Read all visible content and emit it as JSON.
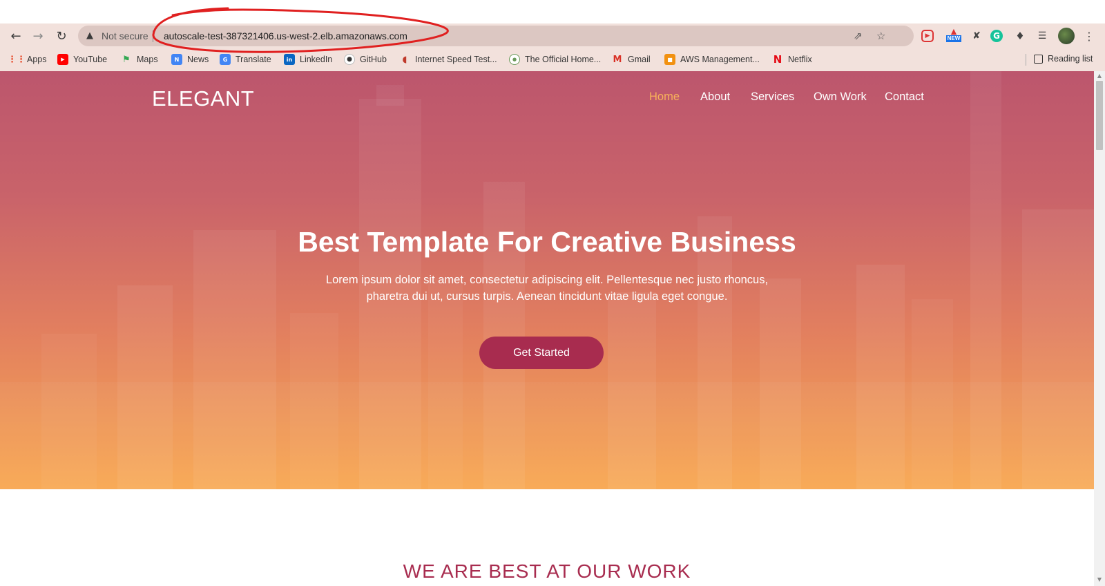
{
  "browser": {
    "security_label": "Not secure",
    "url": "autoscale-test-387321406.us-west-2.elb.amazonaws.com",
    "new_badge": "NEW",
    "bookmarks": [
      {
        "label": "Apps",
        "icon": "apps-grid-icon"
      },
      {
        "label": "YouTube",
        "icon": "youtube-icon"
      },
      {
        "label": "Maps",
        "icon": "maps-pin-icon"
      },
      {
        "label": "News",
        "icon": "google-news-icon"
      },
      {
        "label": "Translate",
        "icon": "google-translate-icon"
      },
      {
        "label": "LinkedIn",
        "icon": "linkedin-icon"
      },
      {
        "label": "GitHub",
        "icon": "github-icon"
      },
      {
        "label": "Internet Speed Test...",
        "icon": "speedometer-icon"
      },
      {
        "label": "The Official Home...",
        "icon": "official-home-icon"
      },
      {
        "label": "Gmail",
        "icon": "gmail-icon"
      },
      {
        "label": "AWS Management...",
        "icon": "aws-icon"
      },
      {
        "label": "Netflix",
        "icon": "netflix-icon"
      }
    ],
    "reading_list": "Reading list"
  },
  "site": {
    "logo": "ELEGANT",
    "nav": [
      "Home",
      "About",
      "Services",
      "Own Work",
      "Contact"
    ],
    "hero": {
      "title": "Best Template For Creative Business",
      "subtitle_line1": "Lorem ipsum dolor sit amet, consectetur adipiscing elit. Pellentesque nec justo rhoncus,",
      "subtitle_line2": "pharetra dui ut, cursus turpis. Aenean tincidunt vitae ligula eget congue.",
      "cta": "Get Started"
    },
    "section_title": "WE ARE BEST AT OUR WORK"
  },
  "colors": {
    "hero_top": "#bc566d",
    "hero_bottom": "#f8a852",
    "nav_active": "#f7b15a",
    "cta": "#a82c4f",
    "annotation": "#e02020"
  }
}
